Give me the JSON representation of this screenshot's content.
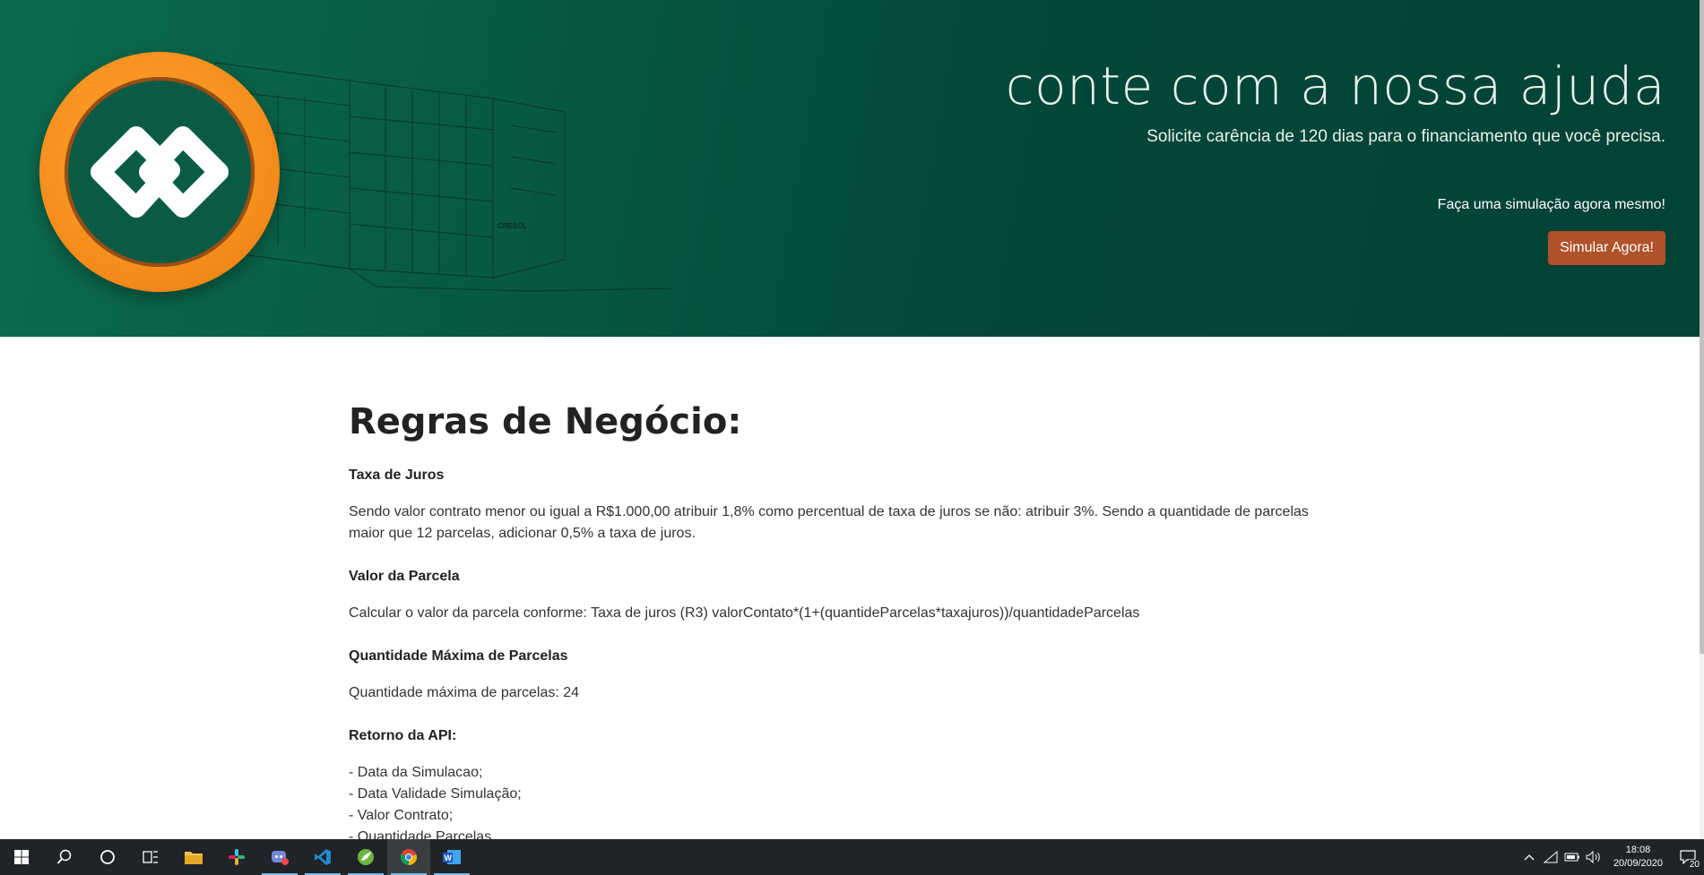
{
  "hero": {
    "title": "conte com a nossa ajuda",
    "subtitle": "Solicite carência de 120 dias para o financiamento que você precisa.",
    "cta_text": "Faça uma simulação agora mesmo!",
    "button_label": "Simular Agora!",
    "building_sign": "CRESOL"
  },
  "content": {
    "heading": "Regras de Negócio:",
    "rules": [
      {
        "title": "Taxa de Juros",
        "text": "Sendo valor contrato menor ou igual a R$1.000,00 atribuir 1,8% como percentual de taxa de juros se não: atribuir 3%. Sendo a quantidade de parcelas maior que 12 parcelas, adicionar 0,5% a taxa de juros."
      },
      {
        "title": "Valor da Parcela",
        "text": "Calcular o valor da parcela conforme: Taxa de juros (R3) valorContato*(1+(quantideParcelas*taxajuros))/quantidadeParcelas"
      },
      {
        "title": "Quantidade Máxima de Parcelas",
        "text": "Quantidade máxima de parcelas: 24"
      },
      {
        "title": "Retorno da API:",
        "lines": [
          "- Data da Simulacao;",
          "- Data Validade Simulação;",
          "- Valor Contrato;",
          "- Quantidade Parcelas"
        ]
      }
    ]
  },
  "taskbar": {
    "apps": [
      "start-icon",
      "search-icon",
      "cortana-icon",
      "task-view-icon",
      "file-explorer-icon",
      "slack-icon",
      "discord-icon",
      "vscode-icon",
      "spring-tool-suite-icon",
      "chrome-icon",
      "word-icon"
    ],
    "clock_time": "18:08",
    "clock_date": "20/09/2020",
    "notification_count": "20"
  },
  "colors": {
    "hero_green": "#075a43",
    "logo_orange": "#f7911d",
    "button_brown": "#b0522a"
  }
}
